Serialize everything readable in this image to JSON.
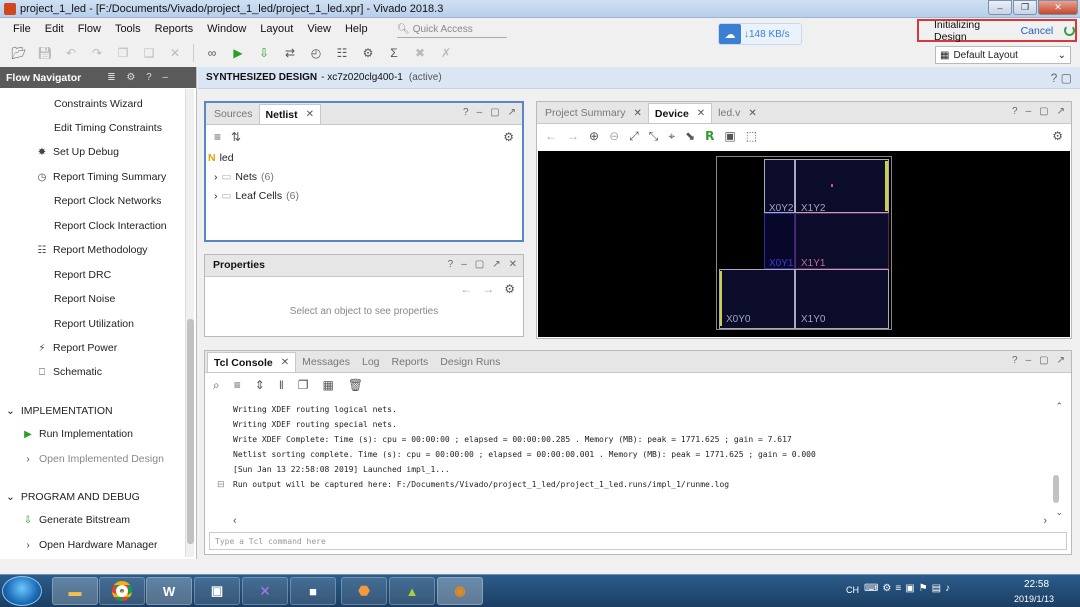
{
  "window": {
    "title": "project_1_led - [F:/Documents/Vivado/project_1_led/project_1_led.xpr] - Vivado 2018.3",
    "buttons": [
      "‒",
      "❐",
      "✕"
    ]
  },
  "menu": [
    "File",
    "Edit",
    "Flow",
    "Tools",
    "Reports",
    "Window",
    "Layout",
    "View",
    "Help"
  ],
  "quick_access": {
    "placeholder": "Quick Access"
  },
  "download_badge": {
    "speed": "148 KB/s"
  },
  "status": {
    "label": "Initializing Design",
    "cancel": "Cancel"
  },
  "layout_select": {
    "value": "Default Layout"
  },
  "flow_navigator": {
    "title": "Flow Navigator",
    "items": [
      {
        "label": "Constraints Wizard",
        "icon": "none",
        "enabled": true
      },
      {
        "label": "Edit Timing Constraints",
        "icon": "none",
        "enabled": true
      },
      {
        "label": "Set Up Debug",
        "icon": "bug-icon",
        "enabled": true
      },
      {
        "label": "Report Timing Summary",
        "icon": "clock-icon",
        "enabled": true
      },
      {
        "label": "Report Clock Networks",
        "icon": "none",
        "enabled": true
      },
      {
        "label": "Report Clock Interaction",
        "icon": "none",
        "enabled": true
      },
      {
        "label": "Report Methodology",
        "icon": "clipboard-icon",
        "enabled": true
      },
      {
        "label": "Report DRC",
        "icon": "none",
        "enabled": true
      },
      {
        "label": "Report Noise",
        "icon": "none",
        "enabled": true
      },
      {
        "label": "Report Utilization",
        "icon": "none",
        "enabled": true
      },
      {
        "label": "Report Power",
        "icon": "power-icon",
        "enabled": true
      },
      {
        "label": "Schematic",
        "icon": "schematic-icon",
        "enabled": true
      }
    ],
    "sections": [
      {
        "title": "IMPLEMENTATION",
        "items": [
          {
            "label": "Run Implementation",
            "enabled": true
          },
          {
            "label": "Open Implemented Design",
            "enabled": false
          }
        ]
      },
      {
        "title": "PROGRAM AND DEBUG",
        "items": [
          {
            "label": "Generate Bitstream",
            "enabled": true
          },
          {
            "label": "Open Hardware Manager",
            "enabled": true
          }
        ]
      }
    ]
  },
  "design_bar": {
    "title": "SYNTHESIZED DESIGN",
    "device": "- xc7z020clg400-1",
    "state": "(active)"
  },
  "netlist_panel": {
    "tabs": [
      "Sources",
      "Netlist"
    ],
    "root": "led",
    "nodes": [
      {
        "label": "Nets",
        "count": "(6)"
      },
      {
        "label": "Leaf Cells",
        "count": "(6)"
      }
    ]
  },
  "properties_panel": {
    "title": "Properties",
    "empty": "Select an object to see properties"
  },
  "device_panel": {
    "tabs": [
      "Project Summary",
      "Device",
      "led.v"
    ],
    "clock_regions": [
      "X0Y2",
      "X1Y2",
      "X0Y1",
      "X1Y1",
      "X0Y0",
      "X1Y0"
    ]
  },
  "console": {
    "tabs": [
      "Tcl Console",
      "Messages",
      "Log",
      "Reports",
      "Design Runs"
    ],
    "lines": [
      "Writing XDEF routing logical nets.",
      "Writing XDEF routing special nets.",
      "Write XDEF Complete: Time (s): cpu = 00:00:00 ; elapsed = 00:00:00.285 . Memory (MB): peak = 1771.625 ; gain = 7.617",
      "Netlist sorting complete. Time (s): cpu = 00:00:00 ; elapsed = 00:00:00.001 . Memory (MB): peak = 1771.625 ; gain = 0.000",
      "[Sun Jan 13 22:58:08 2019] Launched impl_1...",
      "Run output will be captured here: F:/Documents/Vivado/project_1_led/project_1_led.runs/impl_1/runme.log"
    ],
    "input_placeholder": "Type a Tcl command here"
  },
  "taskbar": {
    "apps": [
      "Explorer",
      "Chrome",
      "W",
      "Remote",
      "Visual Studio",
      "Window",
      "PDF",
      "Artboard",
      "Vivado"
    ],
    "lang": "CH",
    "time": "22:58",
    "date": "2019/1/13"
  }
}
